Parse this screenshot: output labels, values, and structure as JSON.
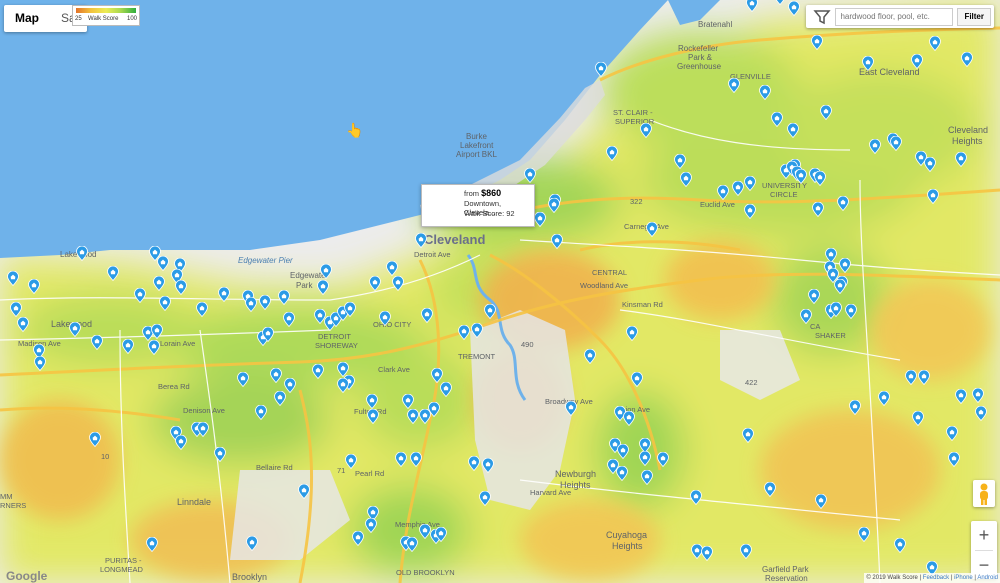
{
  "toolbar": {
    "tabs": [
      {
        "label": "Map",
        "active": true
      },
      {
        "label": "Sa"
      }
    ]
  },
  "legend": {
    "low": "25",
    "title": "Walk Score",
    "high": "100"
  },
  "filter": {
    "placeholder": "hardwood floor, pool, etc.",
    "button": "Filter"
  },
  "popup": {
    "price_prefix": "from",
    "price": "$860",
    "location": "Downtown, Clevela...",
    "walk_score": "Walk Score: 92"
  },
  "places": {
    "cleveland": "Cleveland",
    "lakewood_top": "Lakewood",
    "lakewood": "Lakewood",
    "edgewater": "Edgewater Pier",
    "edgewater_park": "Edgewater Park",
    "burke_1": "Burke",
    "burke_2": "Lakefront",
    "burke_3": "Airport BKL",
    "bratenahl": "Bratenahl",
    "rockefeller_1": "Rockefeller",
    "rockefeller_2": "Park &",
    "rockefeller_3": "Greenhouse",
    "glenville": "GLENVILLE",
    "east_cleveland": "East Cleveland",
    "st_clair_1": "ST. CLAIR -",
    "st_clair_2": "SUPERIOR",
    "university_1": "UNIVERSITY",
    "university_2": "CIRCLE",
    "cleveland_heights_1": "Cleveland",
    "cleveland_heights_2": "Heights",
    "central": "CENTRAL",
    "tremont": "TREMONT",
    "ohio_city": "OHIO CITY",
    "detroit_1": "DETROIT",
    "detroit_2": "SHOREWAY",
    "newburgh_1": "Newburgh",
    "newburgh_2": "Heights",
    "linndale": "Linndale",
    "brooklyn": "Brooklyn",
    "old_brooklyn": "OLD BROOKLYN",
    "cuyahoga_1": "Cuyahoga",
    "cuyahoga_2": "Heights",
    "garfield_1": "Garfield Park",
    "garfield_2": "Reservation",
    "puritas_1": "PURITAS -",
    "puritas_2": "LONGMEAD",
    "rners": "RNERS",
    "mm": "MM",
    "shaker_1": "CA",
    "shaker_2": "SHAKER",
    "woodland": "Woodland Ave",
    "kinsman": "Kinsman Rd",
    "carnegie": "Carnegie Ave",
    "euclid": "Euclid Ave",
    "harvard": "Harvard Ave",
    "detroit_ave": "Detroit Ave",
    "lorain": "Lorain Ave",
    "madison": "Madison Ave",
    "clark": "Clark Ave",
    "denison": "Denison Ave",
    "broadway": "Broadway Ave",
    "fulton": "Fulton Rd",
    "pearl": "Pearl Rd",
    "memphis": "Memphis Ave",
    "union": "Union Ave",
    "bellaire": "Bellaire Rd",
    "berea": "Berea Rd",
    "rte_322": "322",
    "rte_490": "490",
    "rte_71": "71",
    "rte_422": "422",
    "rte_10": "10"
  },
  "attribution": {
    "copyright": "© 2019 Walk Score",
    "feedback": "Feedback",
    "iphone": "iPhone",
    "android": "Android"
  },
  "google": "Google",
  "colors": {
    "water": "#6fb2ea",
    "land": "#ececec",
    "high": "#7cc84a",
    "mid": "#e8ec55",
    "low": "#f0a848",
    "pin": "#2b9be6"
  },
  "icons": {
    "pin": "location-pin-icon",
    "filter": "filter-funnel-icon",
    "pegman": "street-view-pegman-icon",
    "zoom_in": "plus-icon",
    "zoom_out": "minus-icon"
  },
  "zoom": {
    "in": "+",
    "out": "−"
  }
}
